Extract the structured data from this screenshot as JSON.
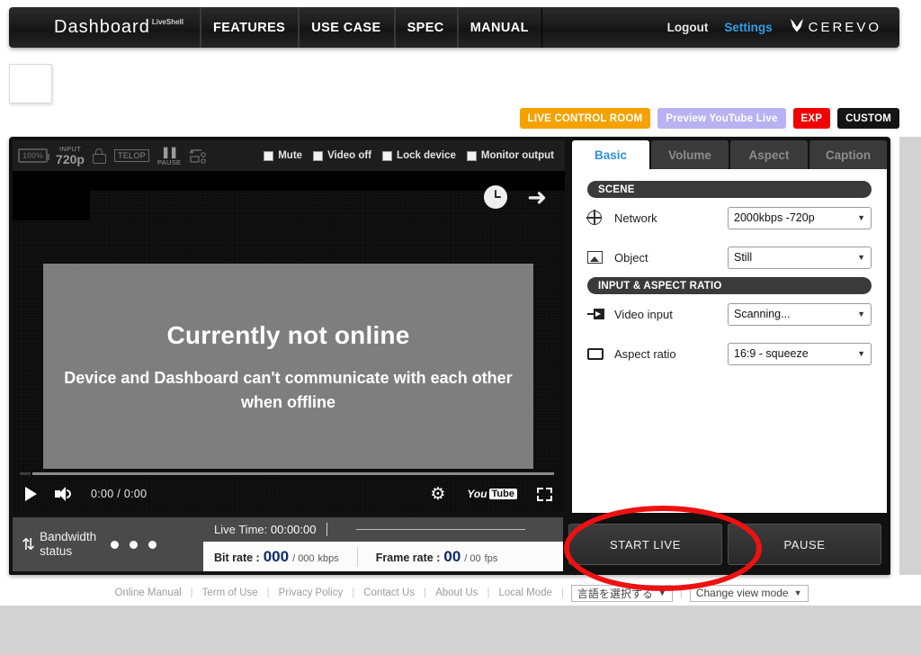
{
  "topnav": {
    "brand": "Dashboard",
    "brand_sub": "LiveShell",
    "items": [
      "FEATURES",
      "USE CASE",
      "SPEC",
      "MANUAL"
    ],
    "logout": "Logout",
    "settings": "Settings",
    "company": "CEREVO"
  },
  "actionbar": {
    "live_control_room": "LIVE CONTROL ROOM",
    "preview_youtube_live": "Preview YouTube Live",
    "exp": "EXP",
    "custom": "CUSTOM"
  },
  "video_toolbar": {
    "battery": "100%",
    "input_label": "INPUT",
    "input_value": "720p",
    "telop": "TELOP",
    "pause": "PAUSE",
    "checkboxes": [
      {
        "label": "Mute",
        "checked": false
      },
      {
        "label": "Video off",
        "checked": false
      },
      {
        "label": "Lock device",
        "checked": false
      },
      {
        "label": "Monitor output",
        "checked": false
      }
    ]
  },
  "video": {
    "offline_title": "Currently not online",
    "offline_message": "Device and Dashboard can't communicate with each other when offline",
    "time": "0:00 / 0:00",
    "youtube_yt": "You",
    "youtube_tube": "Tube"
  },
  "settings": {
    "tabs": [
      {
        "label": "Basic",
        "active": true
      },
      {
        "label": "Volume",
        "active": false
      },
      {
        "label": "Aspect",
        "active": false
      },
      {
        "label": "Caption",
        "active": false
      }
    ],
    "scene_header": "SCENE",
    "input_header": "INPUT & ASPECT RATIO",
    "rows": [
      {
        "label": "Network",
        "value": "2000kbps -720p"
      },
      {
        "label": "Object",
        "value": "Still"
      },
      {
        "label": "Video input",
        "value": "Scanning..."
      },
      {
        "label": "Aspect ratio",
        "value": "16:9 - squeeze"
      }
    ]
  },
  "status": {
    "bandwidth_line1": "Bandwidth",
    "bandwidth_line2": "status",
    "live_time_label": "Live Time:",
    "live_time_value": "00:00:00",
    "bit_rate_label": "Bit rate :",
    "bit_rate_value": "000",
    "bit_rate_max": "/ 000",
    "bit_rate_unit": "kbps",
    "frame_rate_label": "Frame rate  :",
    "frame_rate_value": "00",
    "frame_rate_max": "/ 00",
    "frame_rate_unit": "fps",
    "start_live": "START LIVE",
    "pause": "PAUSE"
  },
  "footer": {
    "links": [
      "Online Manual",
      "Term of Use",
      "Privacy Policy",
      "Contact Us",
      "About Us",
      "Local Mode"
    ],
    "separator": "|",
    "language_select": "言語を選択する",
    "view_mode_select": "Change view mode",
    "caret": "▼"
  }
}
